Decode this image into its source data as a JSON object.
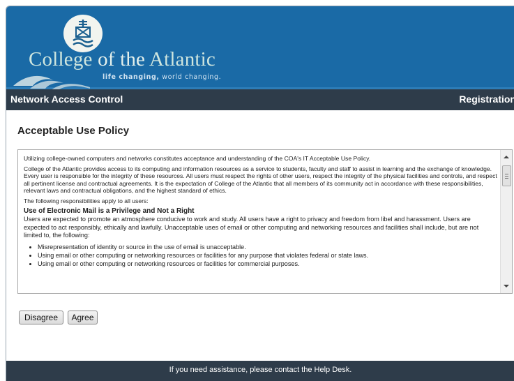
{
  "header": {
    "college_name_part1": "College ",
    "college_name_of": "of the",
    "college_name_part2": " Atlantic",
    "tagline_bold": "life changing,",
    "tagline_rest": " world changing."
  },
  "navbar": {
    "title": "Network Access Control",
    "right_label": "Registration"
  },
  "page": {
    "title": "Acceptable Use Policy"
  },
  "policy": {
    "intro": "Utilizing college-owned computers and networks constitutes acceptance and understanding of the COA's IT Acceptable Use Policy.",
    "paragraph1": "College of the Atlantic provides access to its computing and information resources as a service to students, faculty and staff to assist in learning and the exchange of knowledge. Every user is responsible for the integrity of these resources. All users must respect the rights of other users, respect the integrity of the physical facilities and controls, and respect all pertinent license and contractual agreements. It is the expectation of College of the Atlantic that all members of its community act in accordance with these responsibilities, relevant laws and contractual obligations, and the highest standard of ethics.",
    "responsibilities_intro": "The following responsibilities apply to all users:",
    "section_heading": "Use of Electronic Mail is a Privilege and Not a Right",
    "section_body": "Users are expected to promote an atmosphere conducive to work and study. All users have a right to privacy and freedom from libel and harassment. Users are expected to act responsibly, ethically and lawfully. Unacceptable uses of email or other computing and networking resources and facilities shall include, but are not limited to, the following:",
    "bullets": [
      "Misrepresentation of identity or source in the use of email is unacceptable.",
      "Using email or other computing or networking resources or facilities for any purpose that violates federal or state laws.",
      "Using email or other computing or networking resources or facilities for commercial purposes."
    ]
  },
  "buttons": {
    "disagree": "Disagree",
    "agree": "Agree"
  },
  "footer": {
    "text": "If you need assistance, please contact the Help Desk."
  },
  "colors": {
    "banner": "#1a6aa6",
    "navbar": "#2e3c4a",
    "footer": "#2e3c4a"
  },
  "icons": {
    "emblem": "college-emblem-icon",
    "scroll_up": "scroll-up-arrow-icon",
    "scroll_down": "scroll-down-arrow-icon"
  }
}
